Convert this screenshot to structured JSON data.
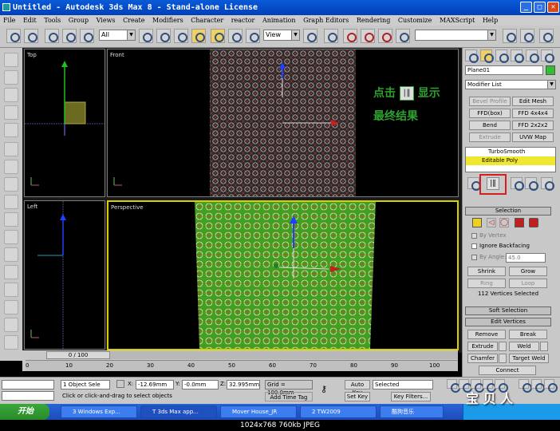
{
  "window": {
    "title": "Untitled - Autodesk 3ds Max 8  - Stand-alone License"
  },
  "menu": [
    "File",
    "Edit",
    "Tools",
    "Group",
    "Views",
    "Create",
    "Modifiers",
    "Character",
    "reactor",
    "Animation",
    "Graph Editors",
    "Rendering",
    "Customize",
    "MAXScript",
    "Help"
  ],
  "toolbar": {
    "selection_filter": "All",
    "ref_coord": "View"
  },
  "viewports": {
    "top": "Top",
    "front": "Front",
    "left": "Left",
    "perspective": "Perspective"
  },
  "annotation": {
    "line1_prefix": "点击",
    "line1_suffix": "显示",
    "line2": "最终结果",
    "icon_glyph": "|‖"
  },
  "panel": {
    "object_name": "Plane01",
    "modifier_list": "Modifier List",
    "mod_buttons": [
      [
        "Bevel Profile",
        "Edit Mesh"
      ],
      [
        "FFD(box)",
        "FFD 4x4x4"
      ],
      [
        "Bend",
        "FFD 2x2x2"
      ],
      [
        "Extrude",
        "UVW Map"
      ]
    ],
    "stack": [
      "TurboSmooth",
      "Editable Poly"
    ],
    "selection_title": "Selection",
    "by_vertex": "By Vertex",
    "ignore_backfacing": "Ignore Backfacing",
    "by_angle": "By Angle:",
    "angle_value": "45.0",
    "shrink": "Shrink",
    "grow": "Grow",
    "ring": "Ring",
    "loop": "Loop",
    "vertices_selected": "112 Vertices Selected",
    "soft_selection": "Soft Selection",
    "edit_vertices": "Edit Vertices",
    "remove": "Remove",
    "break": "Break",
    "extrude": "Extrude",
    "weld": "Weld",
    "chamfer": "Chamfer",
    "target_weld": "Target Weld",
    "connect": "Connect"
  },
  "timeline": {
    "frame": "0 / 100",
    "ticks": [
      "0",
      "10",
      "20",
      "30",
      "40",
      "50",
      "60",
      "70",
      "80",
      "90",
      "100"
    ]
  },
  "status": {
    "selected": "1 Object Sele",
    "x_label": "X:",
    "x_value": "-12.69mm",
    "y_label": "Y:",
    "y_value": "-0.0mm",
    "z_label": "Z:",
    "z_value": "32.995mm",
    "grid": "Grid = 100.0mm",
    "prompt": "Click or click-and-drag to select objects",
    "add_time_tag": "Add Time Tag",
    "auto_key": "Auto Key",
    "set_key": "Set Key",
    "key_mode": "Selected",
    "key_filters": "Key Filters..."
  },
  "taskbar": {
    "start": "开始",
    "tasks": [
      "3 Windows Exp...",
      "T 3ds Max app...",
      "Mover House_JR",
      "2 TW2009",
      "酷狗音乐"
    ],
    "watermark": "宝 贝 人"
  },
  "caption": "1024x768  760kb  JPEG"
}
